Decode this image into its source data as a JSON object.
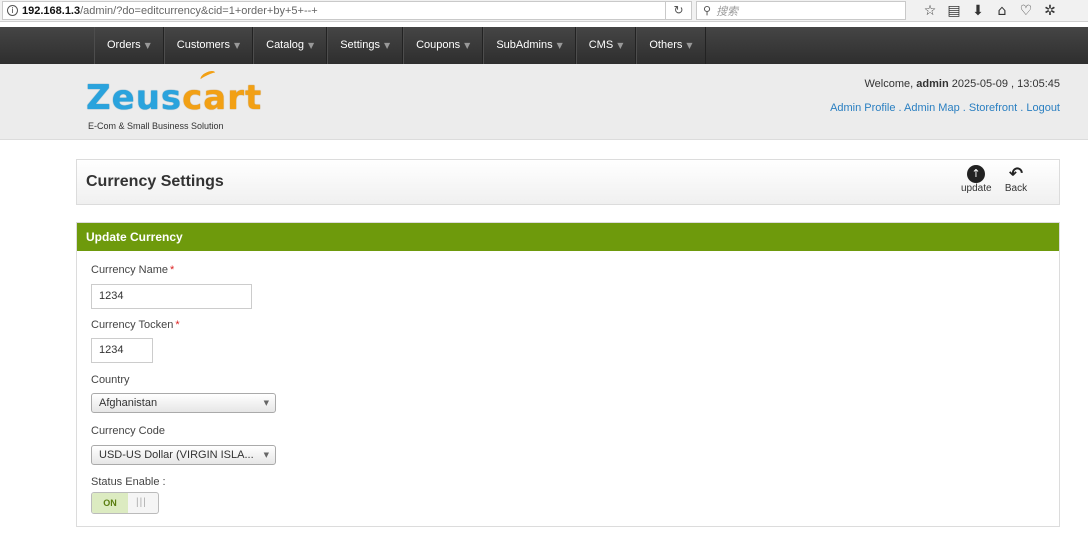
{
  "browser": {
    "url_host": "192.168.1.3",
    "url_path": "/admin/?do=editcurrency&cid=1+order+by+5+--+",
    "search_placeholder": "搜索"
  },
  "nav": {
    "items": [
      {
        "label": "Orders"
      },
      {
        "label": "Customers"
      },
      {
        "label": "Catalog"
      },
      {
        "label": "Settings"
      },
      {
        "label": "Coupons"
      },
      {
        "label": "SubAdmins"
      },
      {
        "label": "CMS"
      },
      {
        "label": "Others"
      }
    ]
  },
  "header": {
    "logo_part1": "Zeus",
    "logo_part2": "cart",
    "tagline": "E-Com & Small Business Solution",
    "welcome_prefix": "Welcome,",
    "username": "admin",
    "datetime": "2025-05-09 , 13:05:45",
    "links": {
      "admin_profile": "Admin Profile",
      "admin_map": "Admin Map",
      "storefront": "Storefront",
      "logout": "Logout"
    }
  },
  "page": {
    "title": "Currency Settings",
    "update_label": "update",
    "back_label": "Back"
  },
  "form": {
    "heading": "Update Currency",
    "currency_name_label": "Currency Name",
    "currency_name_value": "1234",
    "currency_token_label": "Currency Tocken",
    "currency_token_value": "1234",
    "country_label": "Country",
    "country_value": "Afghanistan",
    "currency_code_label": "Currency Code",
    "currency_code_value": "USD-US Dollar (VIRGIN ISLA...",
    "status_label": "Status Enable :",
    "status_value": "ON"
  },
  "colors": {
    "form_header": "#6e9a0c",
    "link": "#2a7fc1",
    "required": "#dd2222"
  }
}
